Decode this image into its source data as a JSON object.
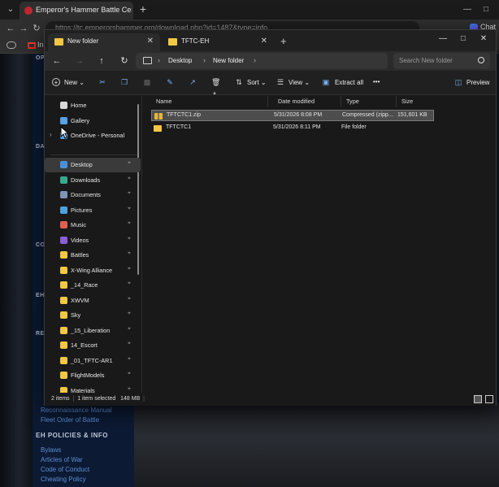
{
  "browser": {
    "tab_title": "Emperor's Hammer Battle Center",
    "new_tab_icon": "plus",
    "url": "https://tc.emperorshammer.org/download.php?id=1487&type=info",
    "bookmark_gmail": "In",
    "chat_label": "Chat"
  },
  "website": {
    "sidebar_headings": [
      "OP",
      "DA",
      "CO",
      "EH",
      "RE"
    ],
    "links_bottom": [
      "Reconnaissance Manual",
      "Fleet Order of Battle"
    ],
    "policy_heading": "EH POLICIES & INFO",
    "policy_links": [
      "Bylaws",
      "Articles of War",
      "Code of Conduct",
      "Cheating Policy"
    ]
  },
  "explorer": {
    "tabs": [
      {
        "title": "New folder"
      },
      {
        "title": "TFTC-EH"
      }
    ],
    "address": {
      "crumbs": [
        "Desktop",
        "New folder"
      ]
    },
    "search_placeholder": "Search New folder",
    "commands": {
      "new": "New",
      "sort": "Sort",
      "view": "View",
      "extract_all": "Extract all",
      "more": "•••",
      "preview": "Preview"
    },
    "nav": {
      "top_items": [
        {
          "label": "Home",
          "icon": "home-icon",
          "color": "#d9d9d9"
        },
        {
          "label": "Gallery",
          "icon": "gallery-icon",
          "color": "#5aa0e8"
        },
        {
          "label": "OneDrive - Personal",
          "icon": "cloud-icon",
          "color": "#5aa0e8"
        }
      ],
      "pinned_items": [
        {
          "label": "Desktop",
          "icon": "desktop-icon",
          "color": "#4a90d9"
        },
        {
          "label": "Downloads",
          "icon": "download-icon",
          "color": "#3aa88c"
        },
        {
          "label": "Documents",
          "icon": "documents-icon",
          "color": "#7f95b8"
        },
        {
          "label": "Pictures",
          "icon": "pictures-icon",
          "color": "#4da2e0"
        },
        {
          "label": "Music",
          "icon": "music-icon",
          "color": "#e0604f"
        },
        {
          "label": "Videos",
          "icon": "videos-icon",
          "color": "#8c5fd6"
        },
        {
          "label": "Battles",
          "icon": "folder-icon",
          "color": "#f2c744"
        },
        {
          "label": "X-Wing Alliance",
          "icon": "folder-icon",
          "color": "#f2c744"
        },
        {
          "label": "_14_Race",
          "icon": "folder-icon",
          "color": "#f2c744"
        },
        {
          "label": "XWVM",
          "icon": "folder-icon",
          "color": "#f2c744"
        },
        {
          "label": "Sky",
          "icon": "folder-icon",
          "color": "#f2c744"
        },
        {
          "label": "_15_Liberation",
          "icon": "folder-icon",
          "color": "#f2c744"
        },
        {
          "label": "14_Escort",
          "icon": "folder-icon",
          "color": "#f2c744"
        },
        {
          "label": "_01_TFTC-AR1",
          "icon": "folder-icon",
          "color": "#f2c744"
        },
        {
          "label": "FlightModels",
          "icon": "folder-icon",
          "color": "#f2c744"
        },
        {
          "label": "Materials",
          "icon": "folder-icon",
          "color": "#f2c744"
        }
      ]
    },
    "columns": [
      "Name",
      "Date modified",
      "Type",
      "Size"
    ],
    "files": [
      {
        "name": "TFTCTC1.zip",
        "date": "5/31/2026 8:08 PM",
        "type": "Compressed (zipp...",
        "size": "151,601 KB",
        "kind": "zip",
        "selected": true
      },
      {
        "name": "TFTCTC1",
        "date": "5/31/2026 8:11 PM",
        "type": "File folder",
        "size": "",
        "kind": "folder",
        "selected": false
      }
    ],
    "status": {
      "items": "2 items",
      "selected": "1 item selected",
      "size": "148 MB"
    }
  }
}
